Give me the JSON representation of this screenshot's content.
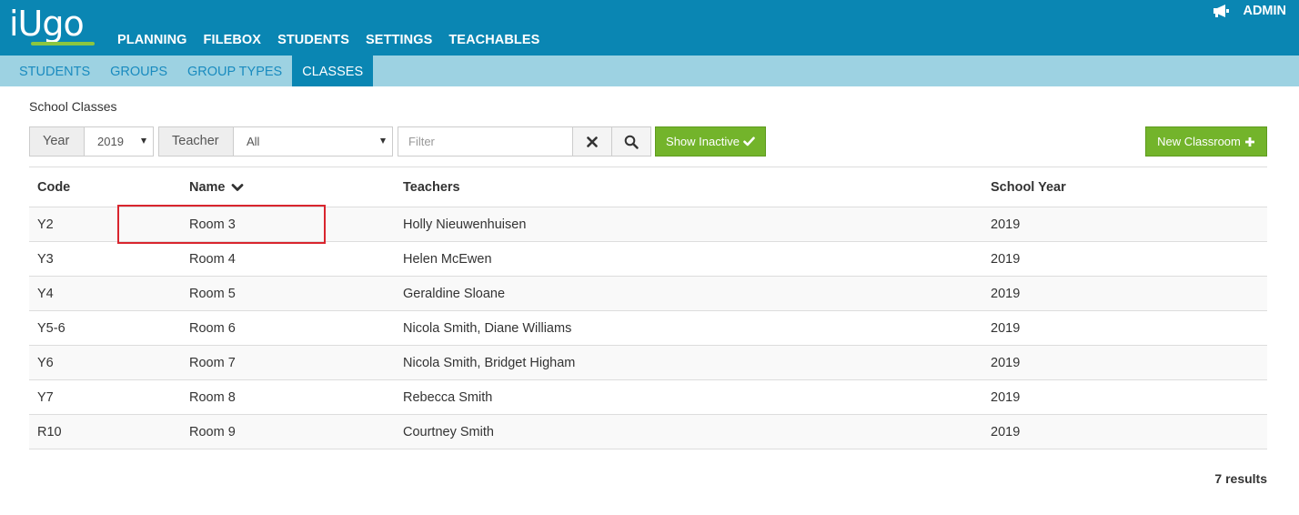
{
  "brand": {
    "logo_text": "iUgo",
    "accent": "#8cc63f",
    "header_bg": "#0a86b3",
    "subnav_bg": "#9dd2e2"
  },
  "header": {
    "nav": [
      "PLANNING",
      "FILEBOX",
      "STUDENTS",
      "SETTINGS",
      "TEACHABLES"
    ],
    "admin_label": "ADMIN",
    "admin_icon": "megaphone-icon"
  },
  "subnav": {
    "items": [
      "STUDENTS",
      "GROUPS",
      "GROUP TYPES",
      "CLASSES"
    ],
    "active": "CLASSES"
  },
  "page": {
    "title": "School Classes"
  },
  "toolbar": {
    "year_label": "Year",
    "year_value": "2019",
    "teacher_label": "Teacher",
    "teacher_value": "All",
    "filter_placeholder": "Filter",
    "clear_icon": "close-icon",
    "search_icon": "search-icon",
    "show_inactive_label": "Show Inactive",
    "new_classroom_label": "New Classroom"
  },
  "table": {
    "columns": [
      "Code",
      "Name",
      "Teachers",
      "School Year"
    ],
    "sorted_by": "Name",
    "rows": [
      {
        "code": "Y2",
        "name": "Room 3",
        "teachers": "Holly Nieuwenhuisen",
        "year": "2019"
      },
      {
        "code": "Y3",
        "name": "Room 4",
        "teachers": "Helen McEwen",
        "year": "2019"
      },
      {
        "code": "Y4",
        "name": "Room 5",
        "teachers": "Geraldine Sloane",
        "year": "2019"
      },
      {
        "code": "Y5-6",
        "name": "Room 6",
        "teachers": "Nicola Smith, Diane Williams",
        "year": "2019"
      },
      {
        "code": "Y6",
        "name": "Room 7",
        "teachers": "Nicola Smith, Bridget Higham",
        "year": "2019"
      },
      {
        "code": "Y7",
        "name": "Room 8",
        "teachers": "Rebecca Smith",
        "year": "2019"
      },
      {
        "code": "R10",
        "name": "Room 9",
        "teachers": "Courtney Smith",
        "year": "2019"
      }
    ]
  },
  "results_text": "7 results"
}
